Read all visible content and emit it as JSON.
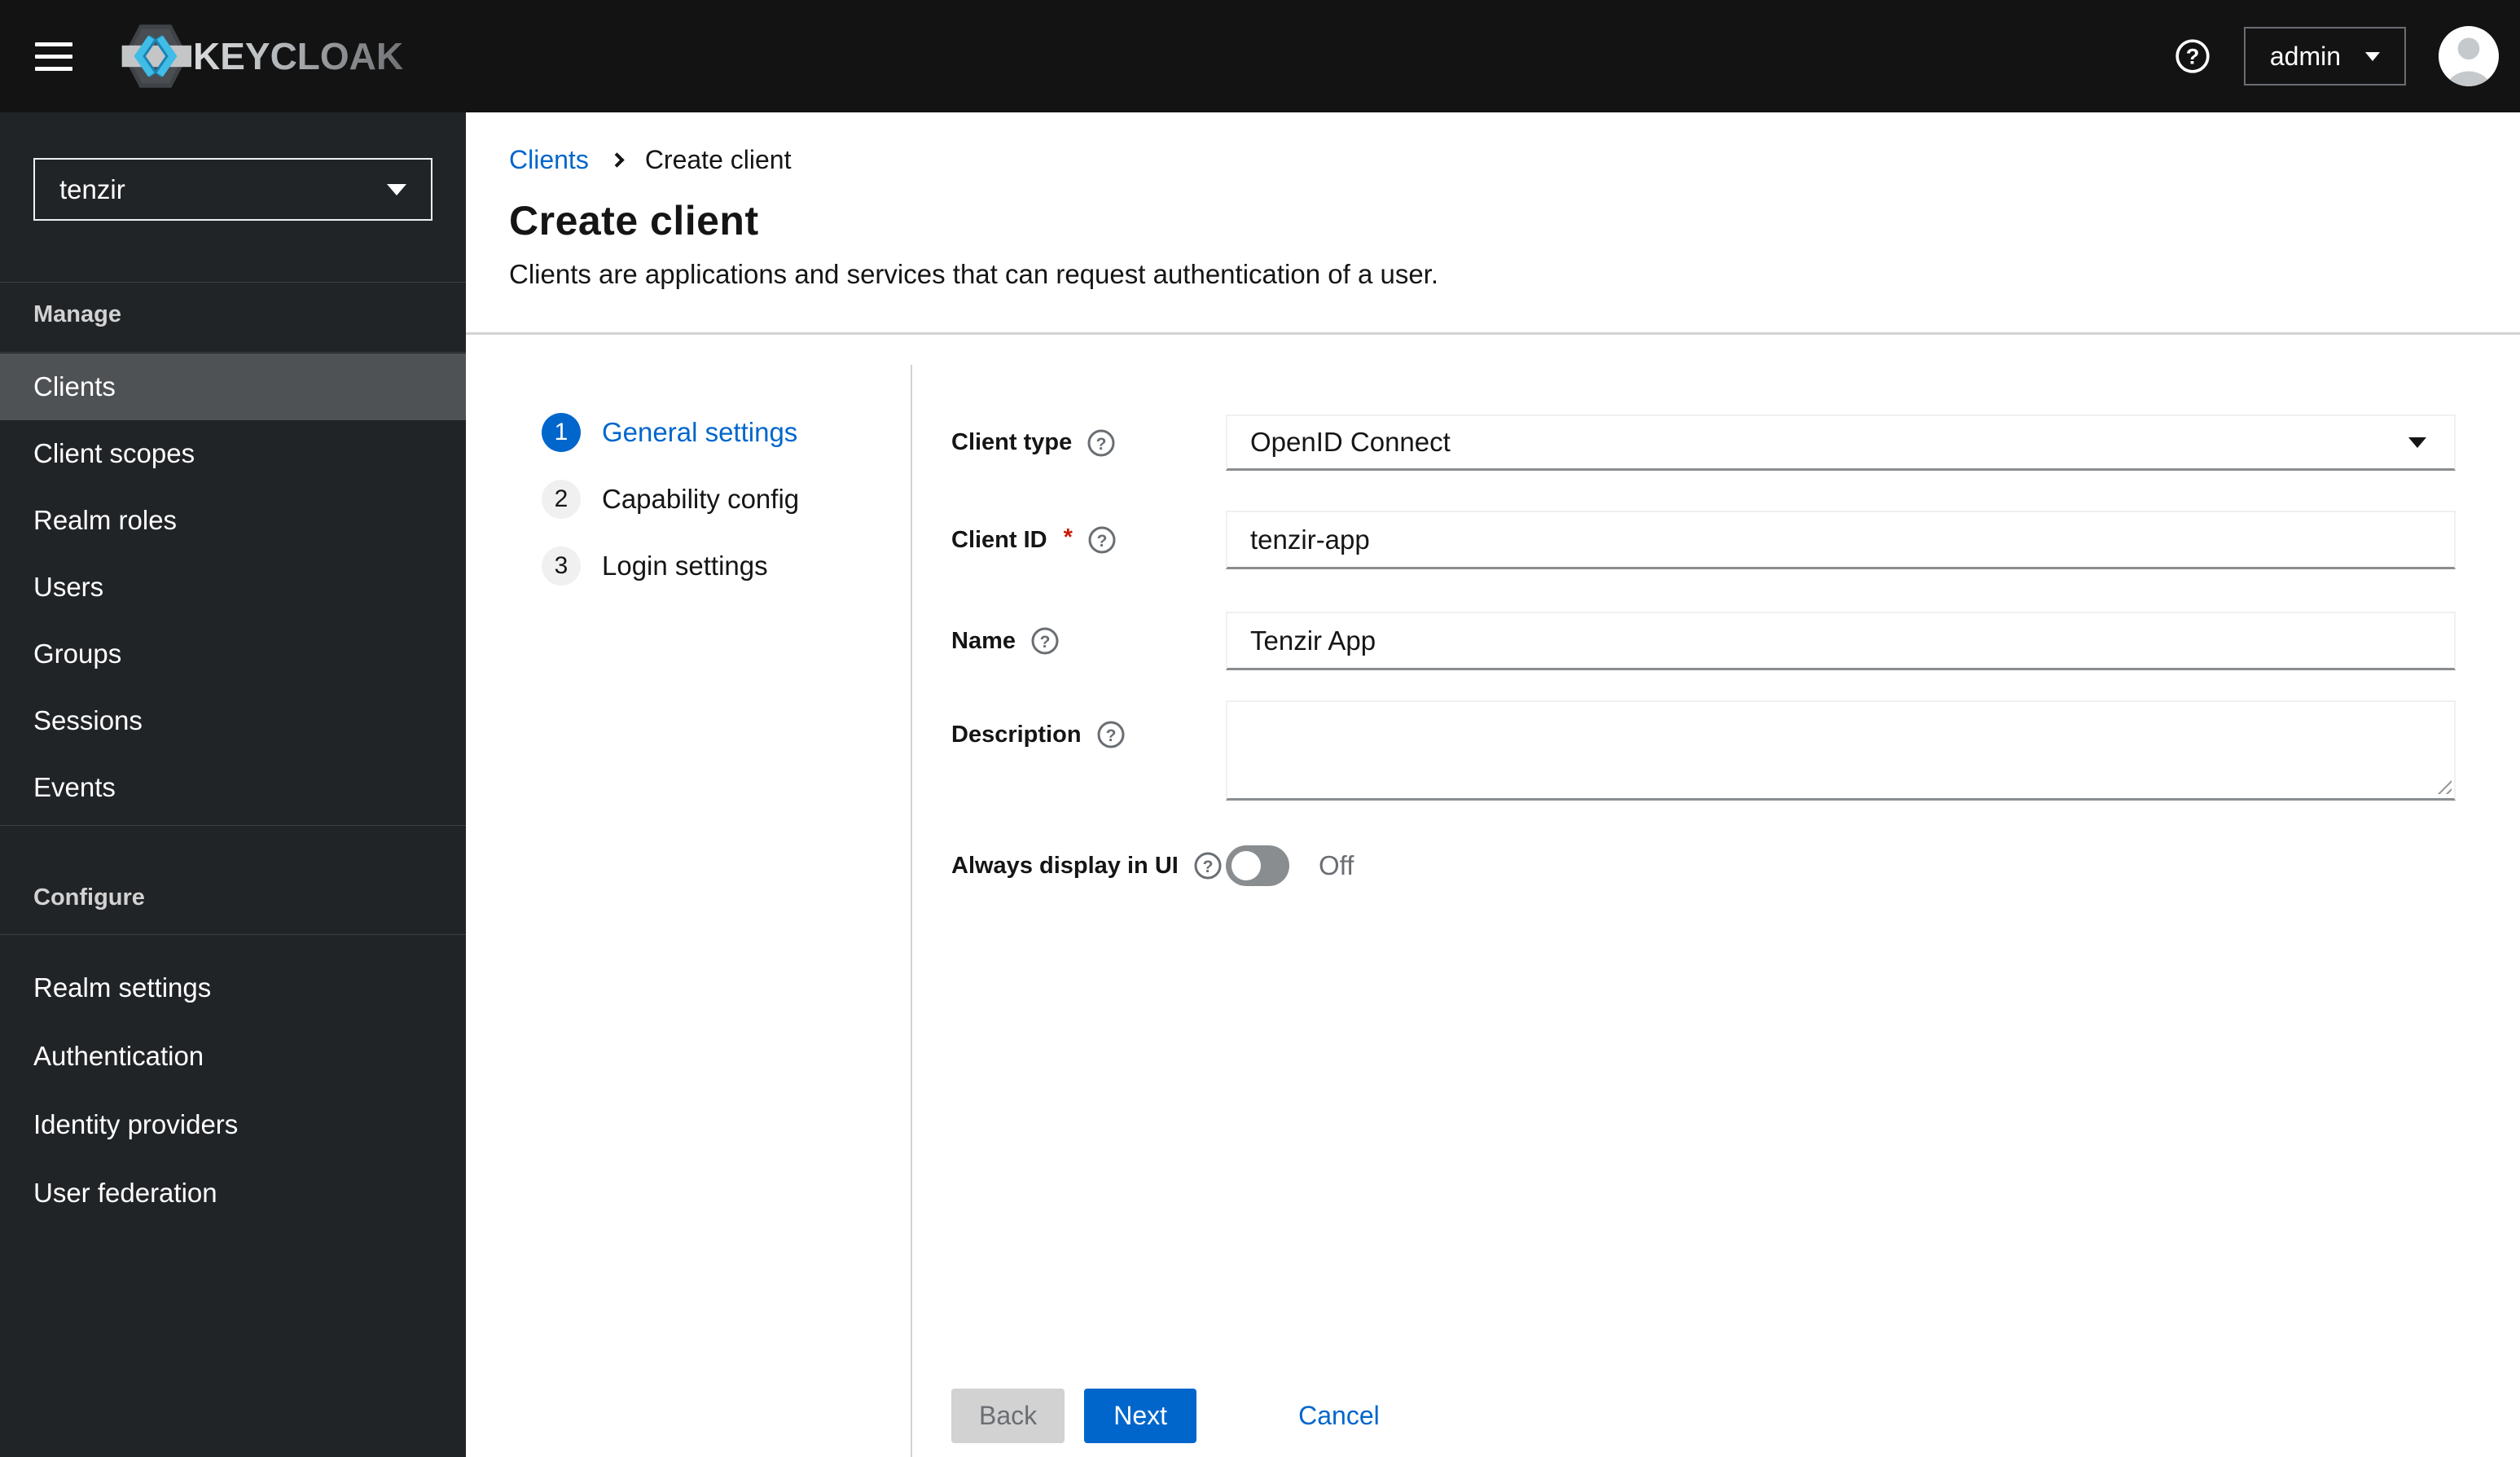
{
  "masthead": {
    "brand": "KEYCLOAK",
    "username": "admin"
  },
  "sidebar": {
    "realm": "tenzir",
    "sections": [
      {
        "title": "Manage",
        "items": [
          {
            "label": "Clients",
            "selected": true
          },
          {
            "label": "Client scopes"
          },
          {
            "label": "Realm roles"
          },
          {
            "label": "Users"
          },
          {
            "label": "Groups"
          },
          {
            "label": "Sessions"
          },
          {
            "label": "Events"
          }
        ]
      },
      {
        "title": "Configure",
        "items": [
          {
            "label": "Realm settings"
          },
          {
            "label": "Authentication"
          },
          {
            "label": "Identity providers"
          },
          {
            "label": "User federation"
          }
        ]
      }
    ]
  },
  "breadcrumb": {
    "items": [
      "Clients",
      "Create client"
    ]
  },
  "page": {
    "title": "Create client",
    "subtitle": "Clients are applications and services that can request authentication of a user."
  },
  "wizard": {
    "steps": [
      {
        "number": "1",
        "label": "General settings",
        "active": true
      },
      {
        "number": "2",
        "label": "Capability config",
        "active": false
      },
      {
        "number": "3",
        "label": "Login settings",
        "active": false
      }
    ]
  },
  "form": {
    "client_type": {
      "label": "Client type",
      "value": "OpenID Connect"
    },
    "client_id": {
      "label": "Client ID",
      "required": "*",
      "value": "tenzir-app"
    },
    "name": {
      "label": "Name",
      "value": "Tenzir App"
    },
    "description": {
      "label": "Description",
      "value": ""
    },
    "always_display": {
      "label": "Always display in UI",
      "state": "Off"
    }
  },
  "footer": {
    "back": "Back",
    "next": "Next",
    "cancel": "Cancel"
  },
  "colors": {
    "accent": "#0066cc",
    "masthead_bg": "#131314",
    "sidebar_bg": "#212427",
    "selected_item_bg": "#4f5255",
    "disabled_button_bg": "#d2d2d2",
    "required_red": "#c9190b"
  }
}
